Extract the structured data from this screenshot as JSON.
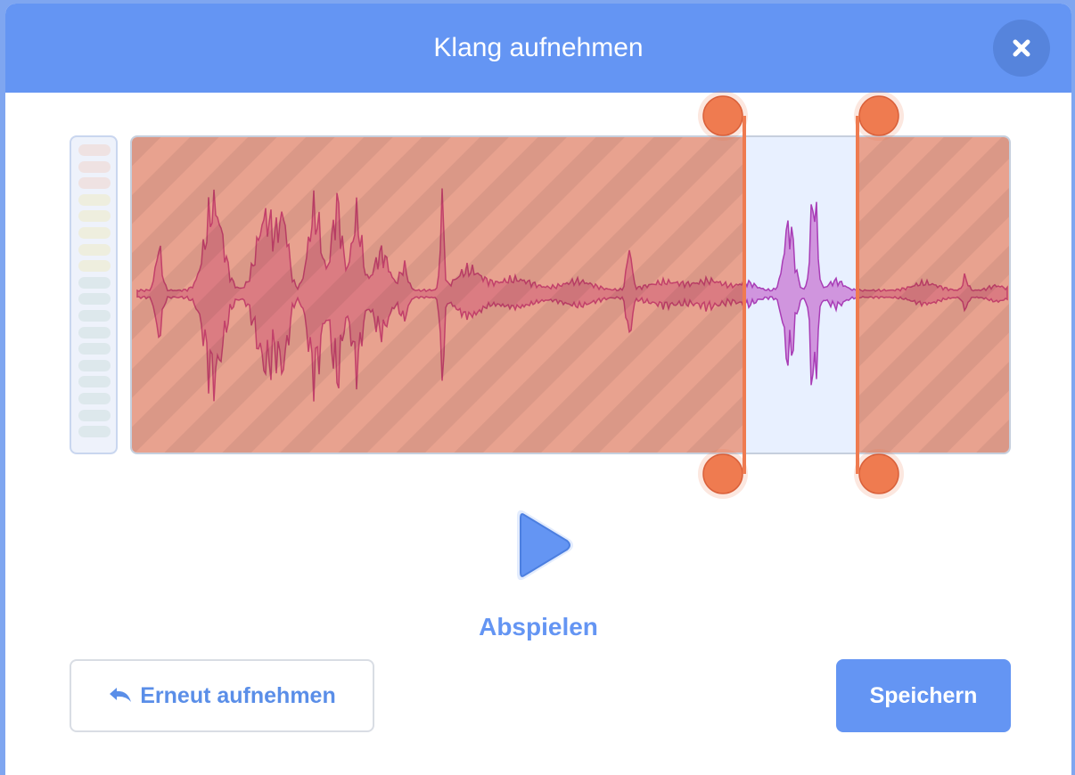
{
  "dialog": {
    "title": "Klang aufnehmen",
    "close_icon": "close-icon"
  },
  "recording": {
    "trim_start": 0.7,
    "trim_end": 0.83
  },
  "playback": {
    "play_label": "Abspielen",
    "play_icon": "play-icon"
  },
  "actions": {
    "rerecord_label": "Erneut aufnehmen",
    "rerecord_icon": "undo-arrow-icon",
    "save_label": "Speichern"
  },
  "colors": {
    "header": "#6495f3",
    "trim_handle": "#ef7b50",
    "waveform_trimmed": "#cf5c79",
    "waveform_selected": "#c364cc",
    "selection_background": "#e8f0ff"
  }
}
